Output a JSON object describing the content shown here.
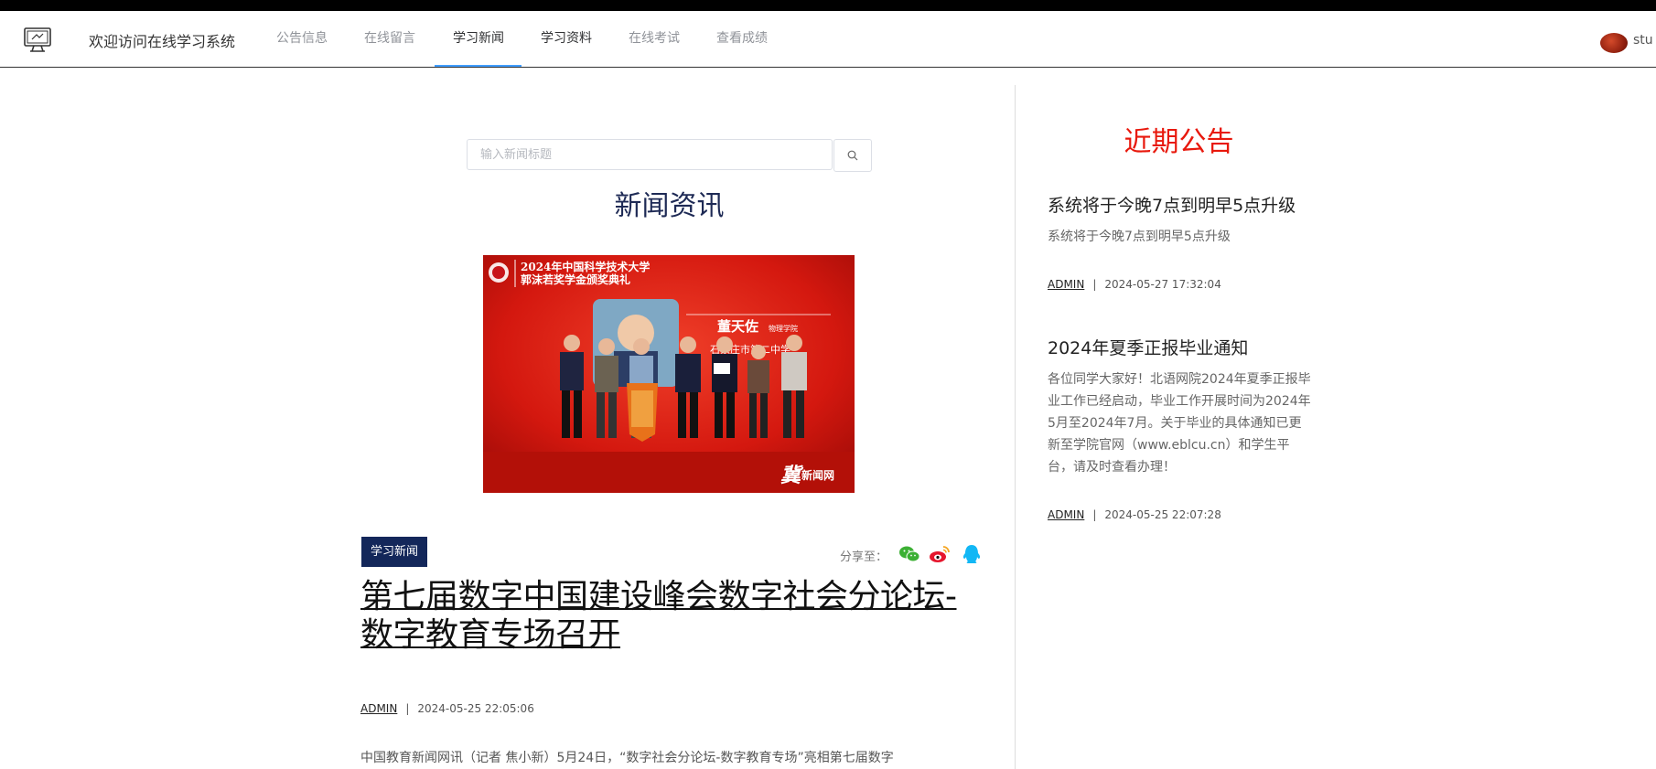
{
  "header": {
    "site_title": "欢迎访问在线学习系统",
    "nav": [
      {
        "label": "公告信息"
      },
      {
        "label": "在线留言"
      },
      {
        "label": "学习新闻"
      },
      {
        "label": "学习资料"
      },
      {
        "label": "在线考试"
      },
      {
        "label": "查看成绩"
      }
    ],
    "active_nav": "学习新闻",
    "username": "stu"
  },
  "search": {
    "placeholder": "输入新闻标题",
    "button_icon": "search-icon"
  },
  "section_title": "新闻资讯",
  "image_caption": {
    "line1": "2024年中国科学技术大学",
    "line2": "郭沫若奖学金颁奖典礼",
    "name": "董天佐",
    "dept": "物理学院",
    "school": "石家庄市第二中学",
    "watermark": "新闻网"
  },
  "article": {
    "category": "学习新闻",
    "share_label": "分享至：",
    "share_icons": [
      "wechat-icon",
      "weibo-icon",
      "qq-icon"
    ],
    "title": "第七届数字中国建设峰会数字社会分论坛-数字教育专场召开",
    "author": "ADMIN",
    "sep": "|",
    "date": "2024-05-25 22:05:06",
    "excerpt": "中国教育新闻网讯（记者 焦小新）5月24日，“数字社会分论坛-数字教育专场”亮相第七届数字"
  },
  "sidebar": {
    "title": "近期公告",
    "announcements": [
      {
        "title": "系统将于今晚7点到明早5点升级",
        "desc": "系统将于今晚7点到明早5点升级",
        "author": "ADMIN",
        "date": "2024-05-27 17:32:04"
      },
      {
        "title": "2024年夏季正报毕业通知",
        "desc": "各位同学大家好！北语网院2024年夏季正报毕业工作已经启动，毕业工作开展时间为2024年5月至2024年7月。关于毕业的具体通知已更新至学院官网（www.eblcu.cn）和学生平台，请及时查看办理！",
        "author": "ADMIN",
        "date": "2024-05-25 22:07:28"
      }
    ]
  },
  "colors": {
    "active_underline": "#409eff",
    "tag_bg": "#13275a",
    "section_title": "#1e2a55",
    "recent_title": "#e8180c"
  }
}
